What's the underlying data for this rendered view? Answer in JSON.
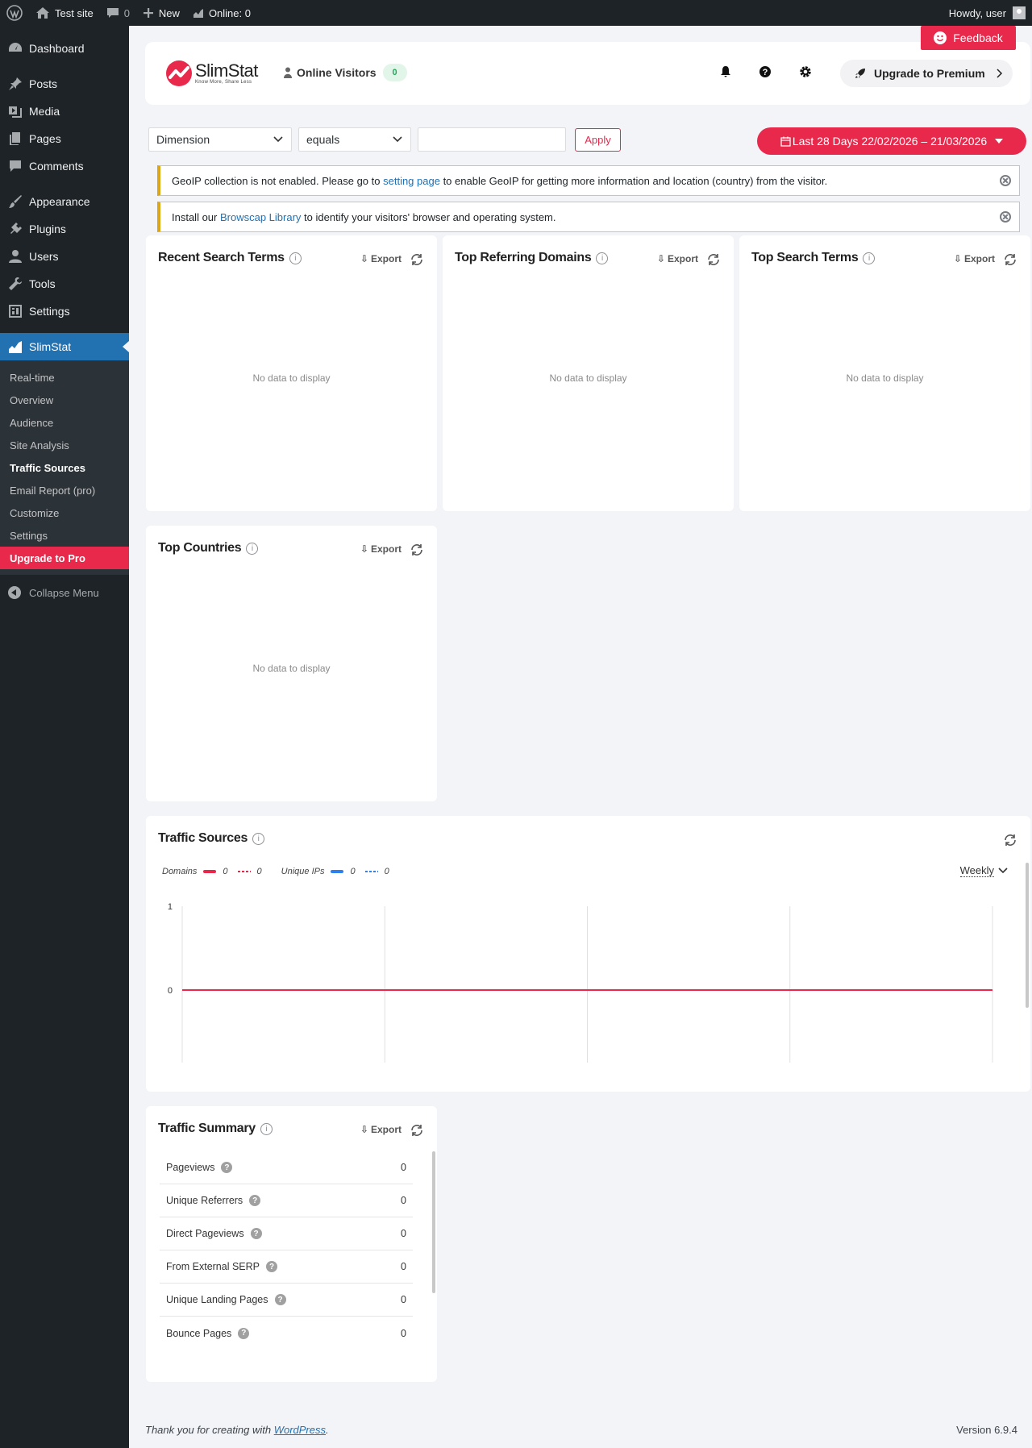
{
  "adminbar": {
    "site_name": "Test site",
    "comments_count": "0",
    "new_label": "New",
    "online_label": "Online: 0",
    "howdy": "Howdy, user"
  },
  "sidebar": {
    "items": [
      {
        "label": "Dashboard",
        "icon": "dashboard-icon"
      },
      {
        "label": "Posts",
        "icon": "pin-icon"
      },
      {
        "label": "Media",
        "icon": "media-icon"
      },
      {
        "label": "Pages",
        "icon": "pages-icon"
      },
      {
        "label": "Comments",
        "icon": "comment-icon"
      },
      {
        "label": "Appearance",
        "icon": "brush-icon"
      },
      {
        "label": "Plugins",
        "icon": "plug-icon"
      },
      {
        "label": "Users",
        "icon": "user-icon"
      },
      {
        "label": "Tools",
        "icon": "wrench-icon"
      },
      {
        "label": "Settings",
        "icon": "settings-icon"
      }
    ],
    "active": {
      "label": "SlimStat",
      "icon": "chart-area-icon"
    },
    "submenu": [
      "Real-time",
      "Overview",
      "Audience",
      "Site Analysis",
      "Traffic Sources",
      "Email Report (pro)",
      "Customize",
      "Settings",
      "Upgrade to Pro"
    ],
    "collapse": "Collapse Menu"
  },
  "header": {
    "logo_name": "SlimStat",
    "logo_tagline": "Know More, Share Less",
    "online_visitors_label": "Online Visitors",
    "online_visitors_count": "0",
    "upgrade_label": "Upgrade to Premium",
    "feedback_label": "Feedback"
  },
  "filters": {
    "dimension": "Dimension",
    "operator": "equals",
    "value": "",
    "apply_label": "Apply",
    "date_range": "Last 28 Days 22/02/2026 – 21/03/2026"
  },
  "notices": {
    "geoip": {
      "before": "GeoIP collection is not enabled. Please go to ",
      "link": "setting page",
      "after": " to enable GeoIP for getting more information and location (country) from the visitor."
    },
    "browscap": {
      "before": "Install our ",
      "link": "Browscap Library",
      "after": " to identify your visitors' browser and operating system."
    }
  },
  "boxes": {
    "export_label": "Export",
    "no_data": "No data to display",
    "recent_search_terms": "Recent Search Terms",
    "top_referring_domains": "Top Referring Domains",
    "top_search_terms": "Top Search Terms",
    "top_countries": "Top Countries"
  },
  "traffic_sources": {
    "title": "Traffic Sources",
    "period": "Weekly",
    "legend": {
      "domains_label": "Domains",
      "domains_current": "0",
      "domains_previous": "0",
      "unique_ips_label": "Unique IPs",
      "unique_ips_current": "0",
      "unique_ips_previous": "0"
    }
  },
  "chart_data": {
    "type": "line",
    "title": "Traffic Sources",
    "ylim": [
      0,
      1
    ],
    "yticks": [
      "1",
      "0"
    ],
    "categories": [
      "",
      "",
      "",
      "",
      ""
    ],
    "series": [
      {
        "name": "Domains",
        "values": [
          0,
          0,
          0,
          0,
          0
        ],
        "color": "#e8294c"
      },
      {
        "name": "Unique IPs",
        "values": [
          0,
          0,
          0,
          0,
          0
        ],
        "color": "#2f80ed"
      }
    ],
    "grid": true
  },
  "summary": {
    "title": "Traffic Summary",
    "rows": [
      {
        "label": "Pageviews",
        "value": "0"
      },
      {
        "label": "Unique Referrers",
        "value": "0"
      },
      {
        "label": "Direct Pageviews",
        "value": "0"
      },
      {
        "label": "From External SERP",
        "value": "0"
      },
      {
        "label": "Unique Landing Pages",
        "value": "0"
      },
      {
        "label": "Bounce Pages",
        "value": "0"
      }
    ]
  },
  "footer": {
    "thanks_before": "Thank you for creating with ",
    "thanks_link": "WordPress",
    "thanks_after": ".",
    "version": "Version 6.9.4"
  },
  "colors": {
    "accent": "#e8294c",
    "wp_blue": "#2271b1",
    "sidebar": "#1d2327",
    "notice": "#dba617"
  }
}
